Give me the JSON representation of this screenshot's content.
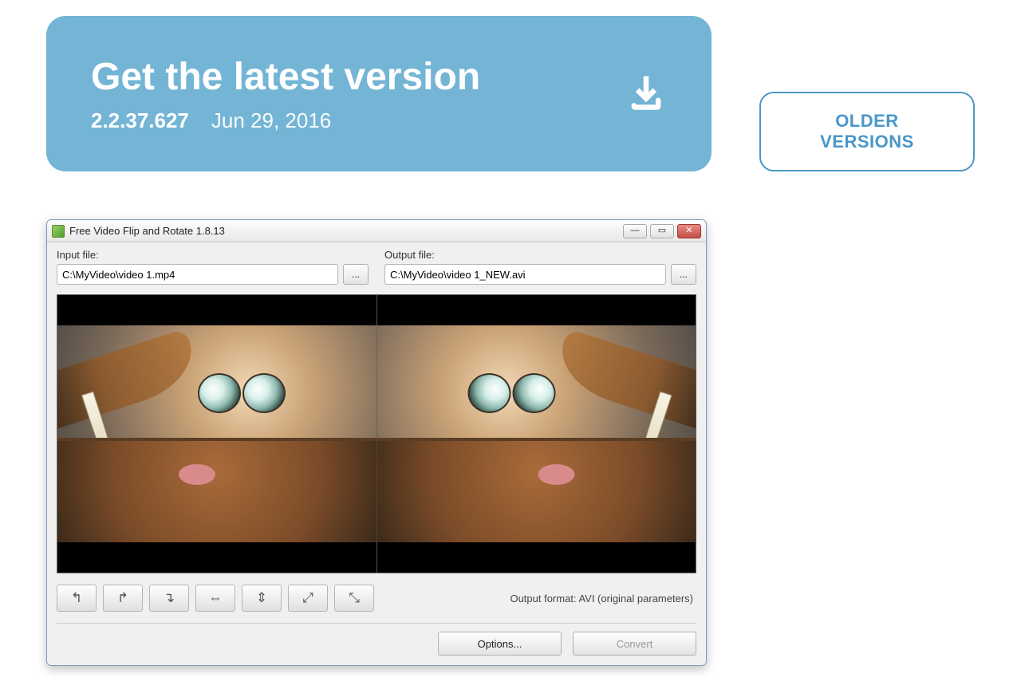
{
  "download_card": {
    "title": "Get the latest version",
    "version": "2.2.37.627",
    "date": "Jun 29, 2016"
  },
  "older_versions_label": "OLDER VERSIONS",
  "app": {
    "title": "Free Video Flip and Rotate 1.8.13",
    "input_label": "Input file:",
    "output_label": "Output file:",
    "input_value": "C:\\MyVideo\\video 1.mp4",
    "output_value": "C:\\MyVideo\\video 1_NEW.avi",
    "browse_label": "...",
    "output_format_prefix": "Output format: ",
    "output_format_value": "AVI (original parameters)",
    "options_label": "Options...",
    "convert_label": "Convert",
    "tool_icons": [
      "↰",
      "↱",
      "↴",
      "⇔",
      "⇕",
      "⤢",
      "⤡"
    ]
  }
}
